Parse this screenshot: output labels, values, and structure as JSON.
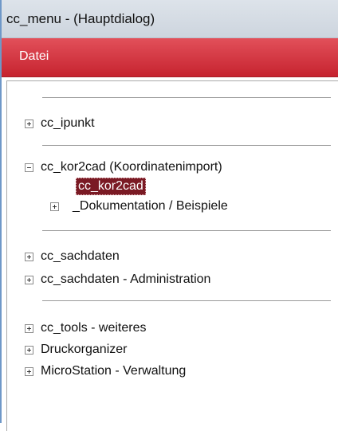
{
  "window": {
    "title": "cc_menu - (Hauptdialog)"
  },
  "menu": {
    "items": [
      {
        "label": "Datei"
      }
    ]
  },
  "tree": {
    "groups": [
      {
        "items": [
          {
            "label": "cc_ipunkt",
            "expanded": false
          }
        ]
      },
      {
        "items": [
          {
            "label": "cc_kor2cad (Koordinatenimport)",
            "expanded": true,
            "children": [
              {
                "label": "cc_kor2cad",
                "selected": true
              },
              {
                "label": "_Dokumentation / Beispiele",
                "expanded": false
              }
            ]
          }
        ]
      },
      {
        "items": [
          {
            "label": "cc_sachdaten",
            "expanded": false
          },
          {
            "label": "cc_sachdaten - Administration",
            "expanded": false
          }
        ]
      },
      {
        "items": [
          {
            "label": "cc_tools - weiteres",
            "expanded": false
          },
          {
            "label": "Druckorganizer",
            "expanded": false
          },
          {
            "label": "MicroStation - Verwaltung",
            "expanded": false
          }
        ]
      }
    ]
  }
}
